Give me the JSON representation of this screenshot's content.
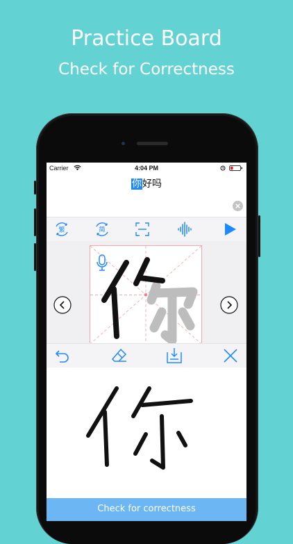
{
  "promo": {
    "title": "Practice Board",
    "subtitle": "Check for Correctness"
  },
  "status_bar": {
    "carrier": "Carrier",
    "time": "4:04 PM"
  },
  "word": {
    "highlighted": "你",
    "rest": "好吗"
  },
  "toolbar": {
    "traditional_label": "繁",
    "simplified_label": "简",
    "icons": [
      "traditional-convert-icon",
      "simplified-convert-icon",
      "scan-icon",
      "audio-waveform-icon",
      "play-icon"
    ]
  },
  "practice_grid": {
    "character": "你",
    "icons": [
      "microphone-icon",
      "chevron-left-icon",
      "chevron-right-icon"
    ]
  },
  "drawing_toolbar": {
    "icons": [
      "undo-icon",
      "eraser-icon",
      "save-icon",
      "close-icon"
    ]
  },
  "colors": {
    "background": "#63d2d2",
    "accent": "#1e88ff",
    "check_button": "#6cb6f4",
    "grid_line": "#f3a7ad"
  },
  "check_button": {
    "label": "Check for correctness"
  }
}
